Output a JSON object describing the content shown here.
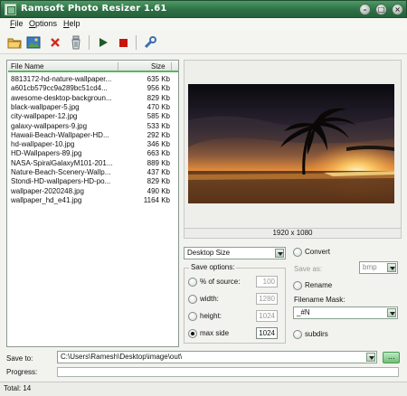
{
  "window": {
    "title": "Ramsoft Photo Resizer 1.61",
    "buttons": [
      "minimize",
      "maximize",
      "close"
    ]
  },
  "menu": {
    "file": {
      "underline": "F",
      "rest": "ile"
    },
    "options": {
      "underline": "O",
      "rest": "ptions"
    },
    "help": {
      "underline": "H",
      "rest": "elp"
    }
  },
  "toolbar": {
    "icons": [
      "open-folder-icon",
      "add-images-icon",
      "remove-icon",
      "clear-icon",
      "play-icon",
      "stop-icon",
      "settings-icon"
    ],
    "colors": {
      "remove": "#d22a1e",
      "play": "#1e5a2a",
      "stop": "#c8140a"
    }
  },
  "file_list": {
    "headers": {
      "name": "File Name",
      "size": "Size"
    },
    "rows": [
      {
        "name": "8813172-hd-nature-wallpaper...",
        "size": "635 Kb"
      },
      {
        "name": "a601cb579cc9a289bc51cd4...",
        "size": "956 Kb"
      },
      {
        "name": "awesome-desktop-backgroun...",
        "size": "829 Kb"
      },
      {
        "name": "black-wallpaper-5.jpg",
        "size": "470 Kb"
      },
      {
        "name": "city-wallpaper-12.jpg",
        "size": "585 Kb"
      },
      {
        "name": "galaxy-wallpapers-9.jpg",
        "size": "533 Kb"
      },
      {
        "name": "Hawaii-Beach-Wallpaper-HD...",
        "size": "292 Kb"
      },
      {
        "name": "hd-wallpaper-10.jpg",
        "size": "346 Kb"
      },
      {
        "name": "HD-Wallpapers-89.jpg",
        "size": "663 Kb"
      },
      {
        "name": "NASA-SpiralGalaxyM101-201...",
        "size": "889 Kb"
      },
      {
        "name": "Nature-Beach-Scenery-Wallp...",
        "size": "437 Kb"
      },
      {
        "name": "Stondi-HD-wallpapers-HD-po...",
        "size": "829 Kb"
      },
      {
        "name": "wallpaper-2020248.jpg",
        "size": "490 Kb"
      },
      {
        "name": "wallpaper_hd_e41.jpg",
        "size": "1164 Kb"
      }
    ]
  },
  "preview": {
    "dimensions": "1920 x 1080"
  },
  "size_mode": {
    "selected": "Desktop Size"
  },
  "save_options": {
    "title": "Save options:",
    "percent": {
      "label": "% of source:",
      "value": "100",
      "checked": false
    },
    "width": {
      "label": "width:",
      "value": "1280",
      "checked": false
    },
    "height": {
      "label": "height:",
      "value": "1024",
      "checked": false
    },
    "max_side": {
      "label": "max side",
      "value": "1024",
      "checked": true
    }
  },
  "convert": {
    "label": "Convert",
    "save_as_label": "Save as:",
    "format": "bmp"
  },
  "rename": {
    "label": "Rename",
    "mask_label": "Filename Mask:",
    "mask_value": "_#N"
  },
  "subdirs": {
    "label": "subdirs"
  },
  "save_to": {
    "label": "Save to:",
    "path": "C:\\Users\\Ramesh\\Desktop\\image\\out\\",
    "browse": "..."
  },
  "progress": {
    "label": "Progress:",
    "value": 0
  },
  "status": {
    "total": "Total: 14"
  }
}
